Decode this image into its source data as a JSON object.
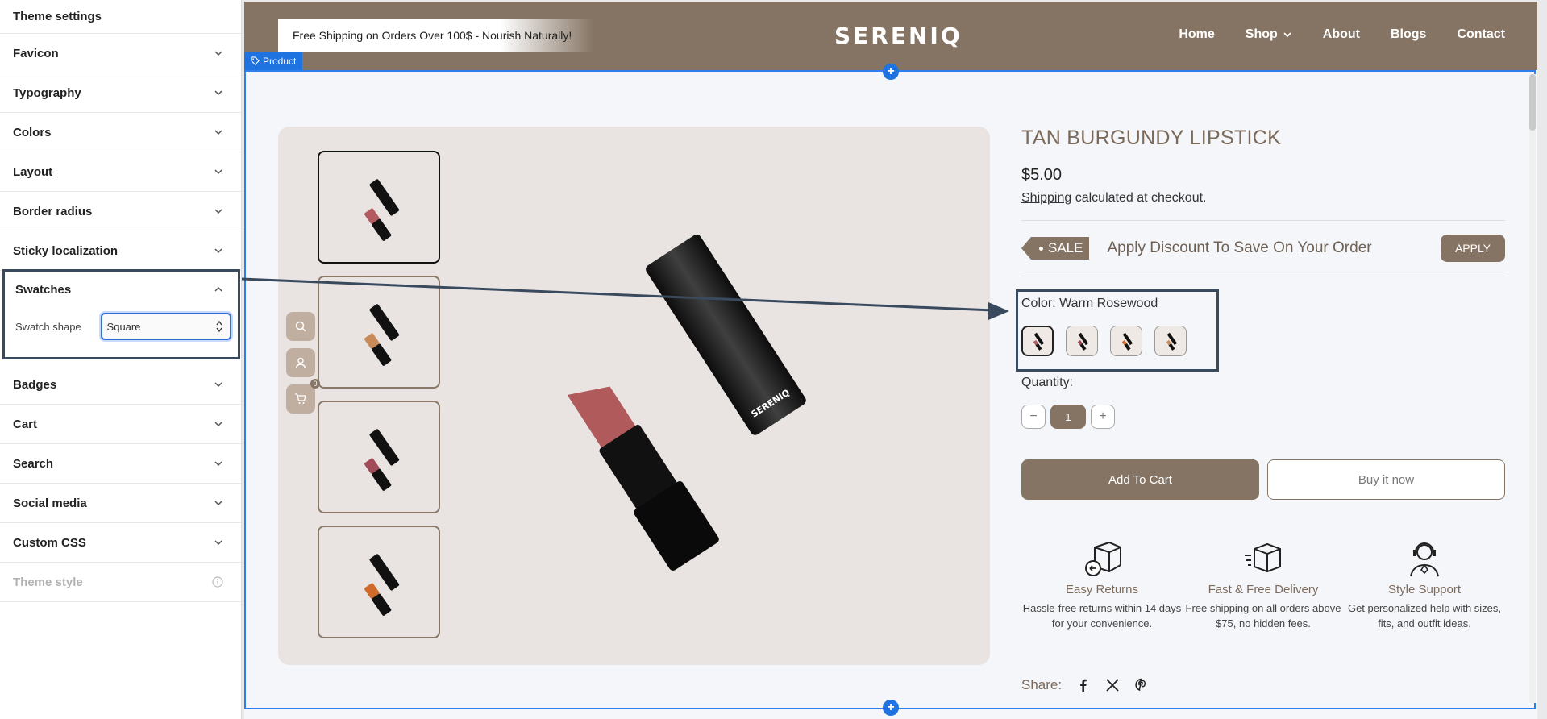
{
  "panel": {
    "title": "Theme settings",
    "sections_top": [
      "Favicon",
      "Typography",
      "Colors",
      "Layout",
      "Border radius",
      "Sticky localization"
    ],
    "swatches": {
      "title": "Swatches",
      "swatch_shape_label": "Swatch shape",
      "swatch_shape_value": "Square"
    },
    "sections_bottom": [
      "Badges",
      "Cart",
      "Search",
      "Social media",
      "Custom CSS"
    ],
    "theme_style": "Theme style"
  },
  "store": {
    "promo": "Free Shipping on Orders Over 100$ - Nourish Naturally!",
    "logo": "SERENIQ",
    "nav": [
      "Home",
      "Shop",
      "About",
      "Blogs",
      "Contact"
    ],
    "product_tag": "Product",
    "cart_count": "0"
  },
  "product": {
    "title": "TAN BURGUNDY LIPSTICK",
    "price": "$5.00",
    "shipping_link": "Shipping",
    "shipping_text": " calculated at checkout.",
    "sale": "SALE",
    "discount_text": "Apply Discount To Save On Your Order",
    "apply": "APPLY",
    "color_label": "Color: Warm Rosewood",
    "quantity_label": "Quantity:",
    "quantity": "1",
    "minus": "−",
    "plus": "+",
    "add_to_cart": "Add To Cart",
    "buy_now": "Buy it now",
    "share": "Share:",
    "lipstick_brand": "SERENIQ"
  },
  "features": [
    {
      "title": "Easy Returns",
      "desc": "Hassle-free returns within 14 days for your convenience."
    },
    {
      "title": "Fast & Free Delivery",
      "desc": "Free shipping on all orders above $75, no hidden fees."
    },
    {
      "title": "Style Support",
      "desc": "Get personalized help with sizes, fits, and outfit ideas."
    }
  ],
  "colors": {
    "brand": "#857463",
    "accent": "#1f73e0",
    "highlight": "#3a4a5e"
  }
}
